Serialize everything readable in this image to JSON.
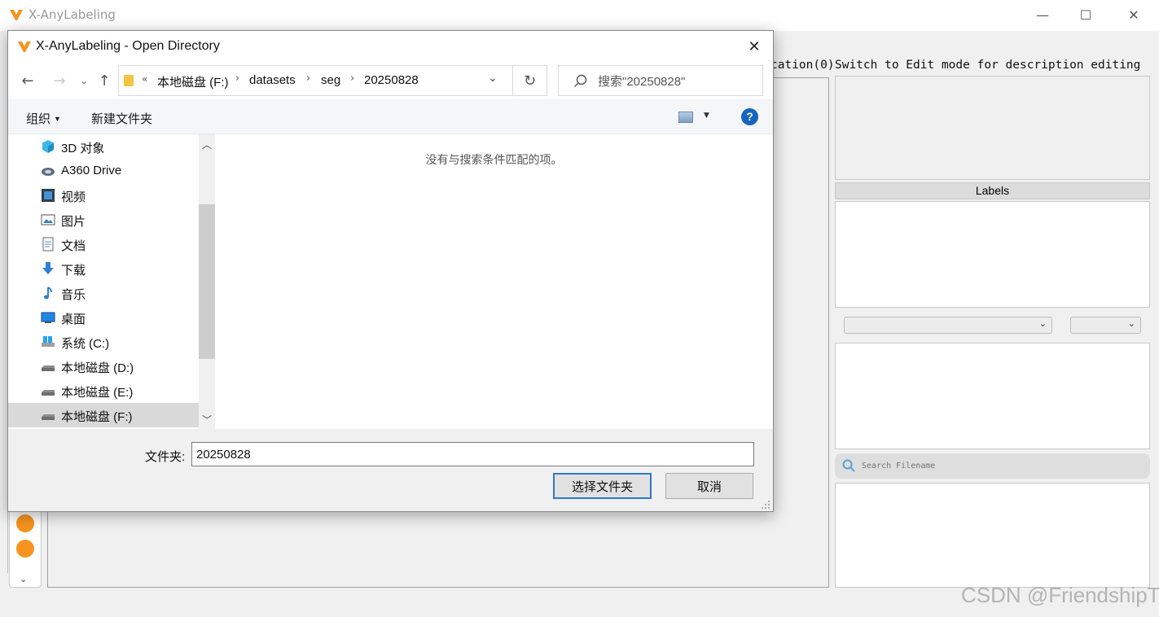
{
  "app": {
    "title": "X-AnyLabeling",
    "window_controls": {
      "minimize": "—",
      "maximize": "☐",
      "close": "✕"
    }
  },
  "right_panel": {
    "description_header_fragment": "cation(0)",
    "description_hint": "Switch to Edit mode for description editing",
    "labels_header": "Labels",
    "search_placeholder": "Search Filename"
  },
  "watermark": "CSDN @FriendshipT",
  "dialog": {
    "title": "X-AnyLabeling - Open Directory",
    "close": "✕",
    "nav": {
      "back": "←",
      "forward": "→",
      "recent": "⌄",
      "up": "↑",
      "refresh": "↻",
      "dropdown": "⌄"
    },
    "address": {
      "overflow": "«",
      "crumbs": [
        "本地磁盘 (F:)",
        "datasets",
        "seg",
        "20250828"
      ]
    },
    "search_placeholder": "搜索\"20250828\"",
    "commands": {
      "organize": "组织",
      "new_folder": "新建文件夹",
      "help": "?"
    },
    "nav_items": [
      {
        "label": "3D 对象",
        "icon": "3d-objects-icon"
      },
      {
        "label": "A360 Drive",
        "icon": "a360-drive-icon"
      },
      {
        "label": "视频",
        "icon": "videos-icon"
      },
      {
        "label": "图片",
        "icon": "pictures-icon"
      },
      {
        "label": "文档",
        "icon": "documents-icon"
      },
      {
        "label": "下载",
        "icon": "downloads-icon"
      },
      {
        "label": "音乐",
        "icon": "music-icon"
      },
      {
        "label": "桌面",
        "icon": "desktop-icon"
      },
      {
        "label": "系统 (C:)",
        "icon": "system-drive-icon"
      },
      {
        "label": "本地磁盘 (D:)",
        "icon": "drive-icon"
      },
      {
        "label": "本地磁盘 (E:)",
        "icon": "drive-icon"
      },
      {
        "label": "本地磁盘 (F:)",
        "icon": "drive-icon",
        "selected": true
      }
    ],
    "empty_message": "没有与搜索条件匹配的项。",
    "folder_label": "文件夹:",
    "folder_value": "20250828",
    "select_button": "选择文件夹",
    "cancel_button": "取消"
  },
  "colors": {
    "accent": "#3178c6",
    "logo": "#f7931e",
    "help": "#1565c0"
  }
}
